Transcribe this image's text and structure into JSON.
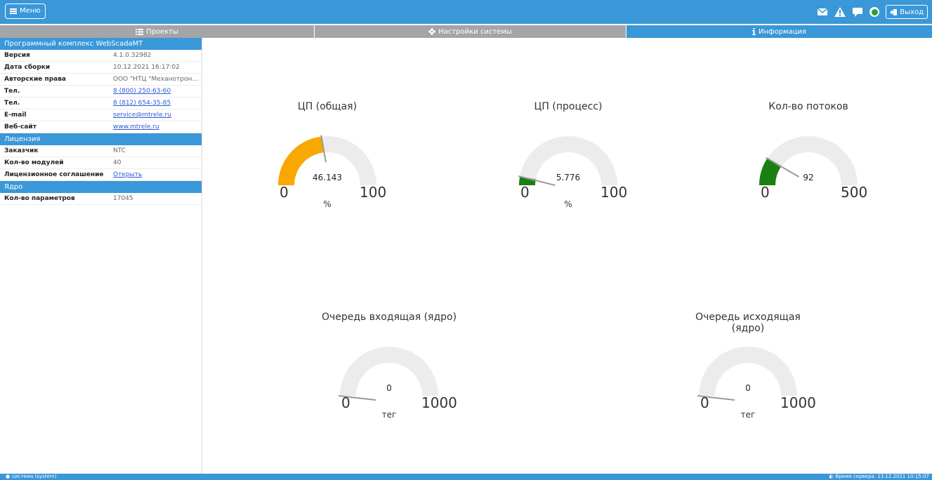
{
  "topbar": {
    "menu_label": "Меню",
    "logout_label": "Выход",
    "icons": [
      "envelope-icon",
      "warning-icon",
      "comment-icon",
      "status-indicator-icon",
      "logout-icon"
    ],
    "accent": "#3a97d8"
  },
  "tabs": [
    {
      "label": "Проекты",
      "icon": "list-icon",
      "active": false
    },
    {
      "label": "Настройки системы",
      "icon": "gear-icon",
      "active": false
    },
    {
      "label": "Информация",
      "icon": "info-icon",
      "active": true
    }
  ],
  "sections": {
    "product": {
      "title": "Программный комплекс WebScadaMT",
      "rows": [
        {
          "key": "Версия",
          "value": "4.1.0.32982"
        },
        {
          "key": "Дата сборки",
          "value": "10.12.2021 16:17:02"
        },
        {
          "key": "Авторские права",
          "value": "ООО \"НТЦ \"Механотроник..."
        },
        {
          "key": "Тел.",
          "value": "8 (800) 250-63-60"
        },
        {
          "key": "Тел.",
          "value": "8 (812) 654-35-85"
        },
        {
          "key": "E-mail",
          "value": "service@mtrele.ru"
        },
        {
          "key": "Веб-сайт",
          "value": "www.mtrele.ru"
        }
      ]
    },
    "license": {
      "title": "Лицензия",
      "rows": [
        {
          "key": "Заказчик",
          "value": "NTC"
        },
        {
          "key": "Кол-во модулей",
          "value": "40"
        },
        {
          "key": "Лицензионное соглашение",
          "value": "Открыть"
        }
      ]
    },
    "core": {
      "title": "Ядро",
      "rows": [
        {
          "key": "Кол-во параметров",
          "value": "17045"
        }
      ]
    }
  },
  "gauges": [
    {
      "title": "ЦП (общая)",
      "value": 46.143,
      "value_text": "46.143",
      "min": "0",
      "max": "100",
      "unit": "%",
      "color": "#f8a800",
      "fraction": 0.46143
    },
    {
      "title": "ЦП (процесс)",
      "value": 5.776,
      "value_text": "5.776",
      "min": "0",
      "max": "100",
      "unit": "%",
      "color": "#1a7f14",
      "fraction": 0.05776
    },
    {
      "title": "Кол-во потоков",
      "value": 92,
      "value_text": "92",
      "min": "0",
      "max": "500",
      "unit": "",
      "color": "#1a7f14",
      "fraction": 0.184
    },
    {
      "title": "Очередь входящая (ядро)",
      "value": 0,
      "value_text": "0",
      "min": "0",
      "max": "1000",
      "unit": "тег",
      "color": "#1a7f14",
      "fraction": 0
    },
    {
      "title": "Очередь исходящая (ядро)",
      "value": 0,
      "value_text": "0",
      "min": "0",
      "max": "1000",
      "unit": "тег",
      "color": "#1a7f14",
      "fraction": 0
    }
  ],
  "statusbar": {
    "user": "система (system)",
    "server_time": "Время сервера: 13.12.2021 10:15:07"
  }
}
